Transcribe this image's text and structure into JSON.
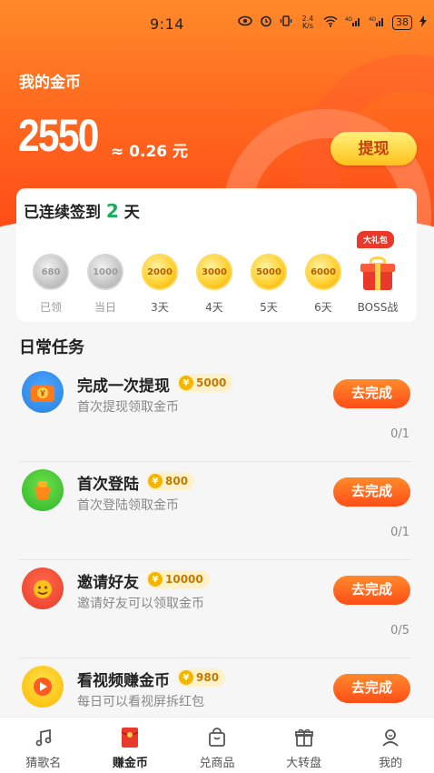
{
  "status_bar": {
    "time": "9:14",
    "net_speed": "2.4 K/s",
    "signal1": "4G",
    "signal2": "4G",
    "battery": "38"
  },
  "wallet": {
    "title": "我的金币",
    "coins": "2550",
    "yuan_value": "≈ 0.26 元",
    "withdraw_label": "提现"
  },
  "signin": {
    "prefix": "已连续签到 ",
    "days": "2",
    "suffix": " 天",
    "gift_badge": "大礼包",
    "days_list": [
      {
        "amount": "680",
        "label": "已领",
        "state": "claimed"
      },
      {
        "amount": "1000",
        "label": "当日",
        "state": "claimed"
      },
      {
        "amount": "2000",
        "label": "3天",
        "state": "pending"
      },
      {
        "amount": "3000",
        "label": "4天",
        "state": "pending"
      },
      {
        "amount": "5000",
        "label": "5天",
        "state": "pending"
      },
      {
        "amount": "6000",
        "label": "6天",
        "state": "pending"
      },
      {
        "amount": "",
        "label": "BOSS战",
        "state": "boss"
      }
    ]
  },
  "tasks_section": {
    "title": "日常任务",
    "button_label": "去完成",
    "items": [
      {
        "name": "完成一次提现",
        "reward": "5000",
        "desc": "首次提现领取金币",
        "progress": "0/1"
      },
      {
        "name": "首次登陆",
        "reward": "800",
        "desc": "首次登陆领取金币",
        "progress": "0/1"
      },
      {
        "name": "邀请好友",
        "reward": "10000",
        "desc": "邀请好友可以领取金币",
        "progress": "0/5"
      },
      {
        "name": "看视频赚金币",
        "reward": "980",
        "desc": "每日可以看视屏拆红包",
        "progress": ""
      }
    ]
  },
  "nav": {
    "items": [
      {
        "label": "猜歌名",
        "icon": "music-note-icon"
      },
      {
        "label": "赚金币",
        "icon": "red-envelope-icon",
        "active": true
      },
      {
        "label": "兑商品",
        "icon": "shopping-bag-icon"
      },
      {
        "label": "大转盘",
        "icon": "gift-box-icon"
      },
      {
        "label": "我的",
        "icon": "profile-icon"
      }
    ]
  },
  "colors": {
    "accent_orange": "#ff5a1f",
    "gold": "#ffcf2e",
    "green_days": "#16b05a"
  }
}
